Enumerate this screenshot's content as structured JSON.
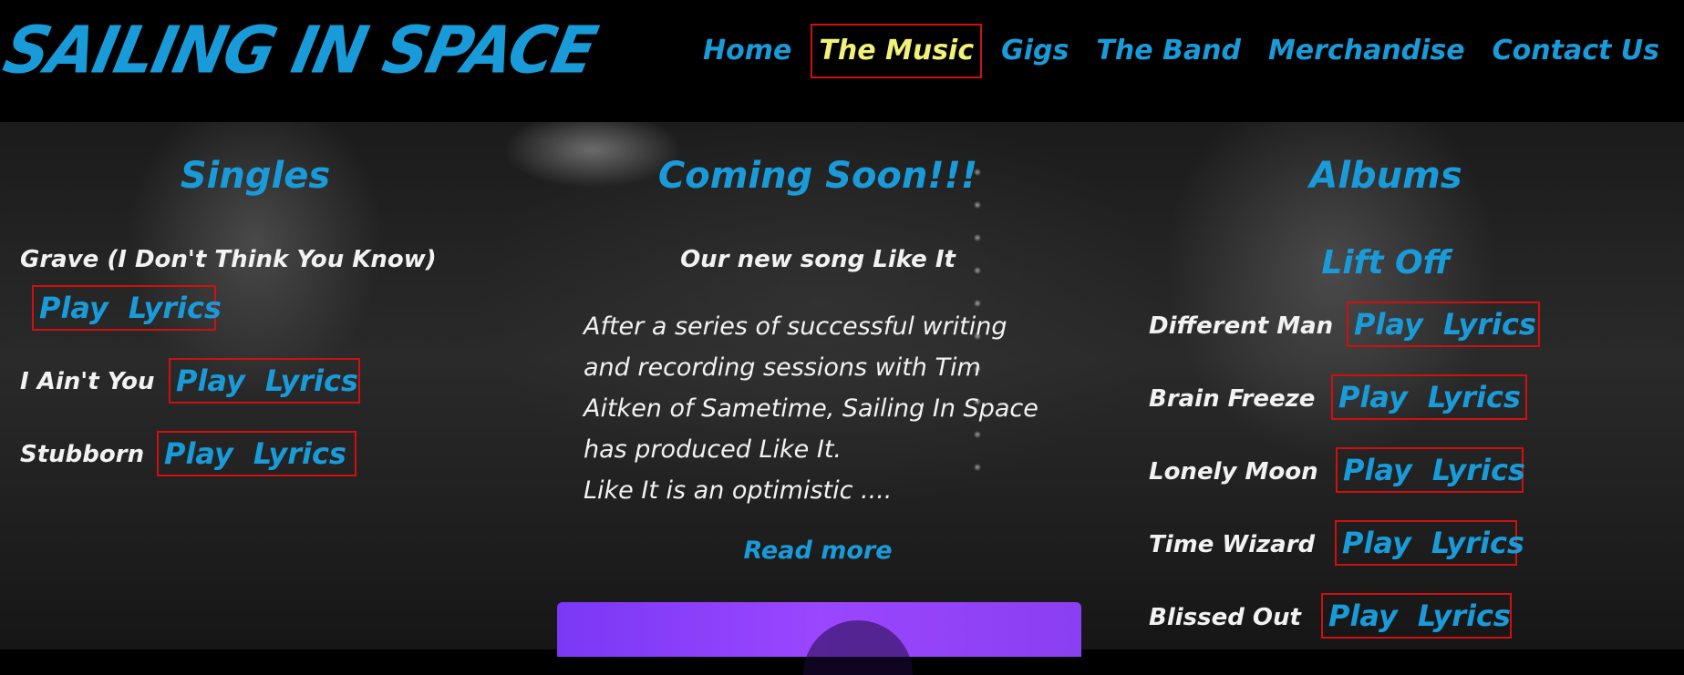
{
  "brand": {
    "logo": "SAILING IN SPACE"
  },
  "nav": [
    {
      "label": "Home",
      "active": false
    },
    {
      "label": "The Music",
      "active": true
    },
    {
      "label": "Gigs",
      "active": false
    },
    {
      "label": "The Band",
      "active": false
    },
    {
      "label": "Merchandise",
      "active": false
    },
    {
      "label": "Contact Us",
      "active": false
    }
  ],
  "singles": {
    "title": "Singles",
    "songs": [
      {
        "name": "Grave (I Don't Think You Know)",
        "play": "Play",
        "lyrics": "Lyrics"
      },
      {
        "name": "I Ain't You",
        "play": "Play",
        "lyrics": "Lyrics"
      },
      {
        "name": "Stubborn",
        "play": "Play",
        "lyrics": "Lyrics"
      }
    ]
  },
  "coming_soon": {
    "title": "Coming Soon!!!",
    "subtitle": "Our new song Like It",
    "description_lines": [
      "After a series of successful writing",
      "and recording sessions with Tim",
      "Aitken of Sametime, Sailing In Space",
      "has produced Like It.",
      "Like It is an optimistic ...."
    ],
    "read_more": "Read more"
  },
  "albums": {
    "title": "Albums",
    "album_name": "Lift Off",
    "songs": [
      {
        "name": "Different Man",
        "play": "Play",
        "lyrics": "Lyrics"
      },
      {
        "name": "Brain Freeze",
        "play": "Play",
        "lyrics": "Lyrics"
      },
      {
        "name": "Lonely Moon",
        "play": "Play",
        "lyrics": "Lyrics"
      },
      {
        "name": "Time Wizard",
        "play": "Play",
        "lyrics": "Lyrics"
      },
      {
        "name": "Blissed Out",
        "play": "Play",
        "lyrics": "Lyrics"
      }
    ]
  },
  "colors": {
    "accent": "#1a9bd9",
    "active_nav": "#f2f27a",
    "highlight_border": "#d01010",
    "background": "#000000"
  }
}
